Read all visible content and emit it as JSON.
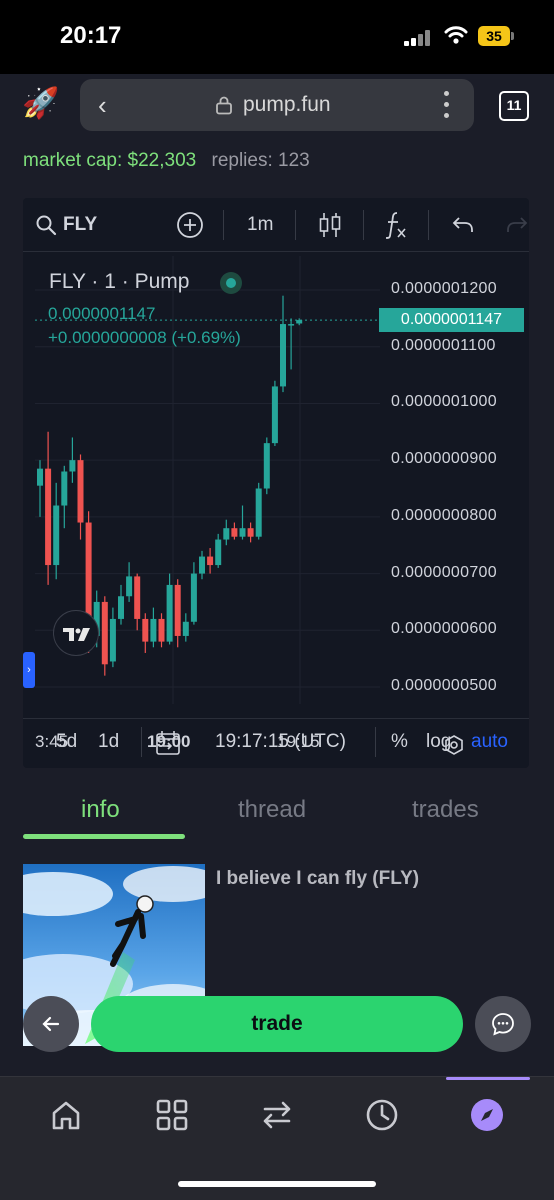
{
  "status": {
    "time": "20:17",
    "battery": "35"
  },
  "browser": {
    "url": "pump.fun",
    "tab_count": "11"
  },
  "token_info": {
    "market_cap": "market cap: $22,303",
    "replies": "replies: 123"
  },
  "chart_toolbar": {
    "symbol": "FLY",
    "timeframe": "1m"
  },
  "chart_legend": {
    "title": "FLY · 1 · Pump",
    "price": "0.0000001147",
    "change": "+0.0000000008 (+0.69%)"
  },
  "chart_bottom": {
    "range_5d": "5d",
    "range_1d": "1d",
    "clock": "19:17:15 (UTC)",
    "percent": "%",
    "log": "log",
    "auto": "auto"
  },
  "chart_data": {
    "type": "candlestick",
    "price_axis": [
      "0.0000001200",
      "0.0000001100",
      "0.0000001000",
      "0.0000000900",
      "0.0000000800",
      "0.0000000700",
      "0.0000000600",
      "0.0000000500"
    ],
    "current_price_tag": "0.0000001147",
    "time_axis": [
      "3:45",
      "19:00",
      "19:15"
    ],
    "ylim": [
      4.7e-08,
      1.26e-07
    ],
    "candles": [
      {
        "o": 8.55e-08,
        "c": 8.85e-08,
        "h": 9e-08,
        "l": 8e-08
      },
      {
        "o": 8.85e-08,
        "c": 7.15e-08,
        "h": 9.5e-08,
        "l": 6.8e-08
      },
      {
        "o": 7.15e-08,
        "c": 8.2e-08,
        "h": 8.6e-08,
        "l": 6.9e-08
      },
      {
        "o": 8.2e-08,
        "c": 8.8e-08,
        "h": 8.9e-08,
        "l": 7.8e-08
      },
      {
        "o": 8.8e-08,
        "c": 9e-08,
        "h": 9.4e-08,
        "l": 8.6e-08
      },
      {
        "o": 9e-08,
        "c": 7.9e-08,
        "h": 9.1e-08,
        "l": 7.6e-08
      },
      {
        "o": 7.9e-08,
        "c": 5.9e-08,
        "h": 8.1e-08,
        "l": 5.6e-08
      },
      {
        "o": 5.9e-08,
        "c": 6.5e-08,
        "h": 6.7e-08,
        "l": 5.7e-08
      },
      {
        "o": 6.5e-08,
        "c": 5.4e-08,
        "h": 6.6e-08,
        "l": 5.2e-08
      },
      {
        "o": 5.45e-08,
        "c": 6.2e-08,
        "h": 6.4e-08,
        "l": 5.35e-08
      },
      {
        "o": 6.2e-08,
        "c": 6.6e-08,
        "h": 6.8e-08,
        "l": 6.1e-08
      },
      {
        "o": 6.6e-08,
        "c": 6.95e-08,
        "h": 7.2e-08,
        "l": 6.5e-08
      },
      {
        "o": 6.95e-08,
        "c": 6.2e-08,
        "h": 7e-08,
        "l": 6e-08
      },
      {
        "o": 6.2e-08,
        "c": 5.8e-08,
        "h": 6.3e-08,
        "l": 5.6e-08
      },
      {
        "o": 5.8e-08,
        "c": 6.2e-08,
        "h": 6.4e-08,
        "l": 5.7e-08
      },
      {
        "o": 6.2e-08,
        "c": 5.8e-08,
        "h": 6.3e-08,
        "l": 5.7e-08
      },
      {
        "o": 5.8e-08,
        "c": 6.8e-08,
        "h": 7e-08,
        "l": 5.75e-08
      },
      {
        "o": 6.8e-08,
        "c": 5.9e-08,
        "h": 6.9e-08,
        "l": 5.7e-08
      },
      {
        "o": 5.9e-08,
        "c": 6.15e-08,
        "h": 6.3e-08,
        "l": 5.8e-08
      },
      {
        "o": 6.15e-08,
        "c": 7e-08,
        "h": 7.2e-08,
        "l": 6.1e-08
      },
      {
        "o": 7e-08,
        "c": 7.3e-08,
        "h": 7.4e-08,
        "l": 6.9e-08
      },
      {
        "o": 7.3e-08,
        "c": 7.15e-08,
        "h": 7.45e-08,
        "l": 7e-08
      },
      {
        "o": 7.15e-08,
        "c": 7.6e-08,
        "h": 7.7e-08,
        "l": 7.1e-08
      },
      {
        "o": 7.6e-08,
        "c": 7.8e-08,
        "h": 7.95e-08,
        "l": 7.5e-08
      },
      {
        "o": 7.8e-08,
        "c": 7.65e-08,
        "h": 7.9e-08,
        "l": 7.6e-08
      },
      {
        "o": 7.65e-08,
        "c": 7.8e-08,
        "h": 8.2e-08,
        "l": 7.6e-08
      },
      {
        "o": 7.8e-08,
        "c": 7.65e-08,
        "h": 7.9e-08,
        "l": 7.55e-08
      },
      {
        "o": 7.65e-08,
        "c": 8.5e-08,
        "h": 8.6e-08,
        "l": 7.6e-08
      },
      {
        "o": 8.5e-08,
        "c": 9.3e-08,
        "h": 9.4e-08,
        "l": 8.4e-08
      },
      {
        "o": 9.3e-08,
        "c": 1.03e-07,
        "h": 1.04e-07,
        "l": 9.25e-08
      },
      {
        "o": 1.03e-07,
        "c": 1.14e-07,
        "h": 1.19e-07,
        "l": 1.02e-07
      },
      {
        "o": 1.14e-07,
        "c": 1.14e-07,
        "h": 1.15e-07,
        "l": 1.06e-07
      },
      {
        "o": 1.141e-07,
        "c": 1.147e-07,
        "h": 1.15e-07,
        "l": 1.138e-07
      }
    ],
    "colors": {
      "up": "#26a69a",
      "down": "#ef5350"
    }
  },
  "tabs": [
    {
      "label": "info",
      "active": true
    },
    {
      "label": "thread",
      "active": false
    },
    {
      "label": "trades",
      "active": false
    }
  ],
  "token": {
    "title": "I believe I can fly (FLY)"
  },
  "actions": {
    "trade_label": "trade"
  },
  "bottom_nav": [
    {
      "icon": "home-icon"
    },
    {
      "icon": "grid-icon"
    },
    {
      "icon": "swap-icon"
    },
    {
      "icon": "history-icon"
    },
    {
      "icon": "compass-icon",
      "active": true
    }
  ],
  "colors": {
    "accent_green": "#7ee07c",
    "trade_button": "#2bd46f",
    "nav_active": "#a78bfa"
  }
}
